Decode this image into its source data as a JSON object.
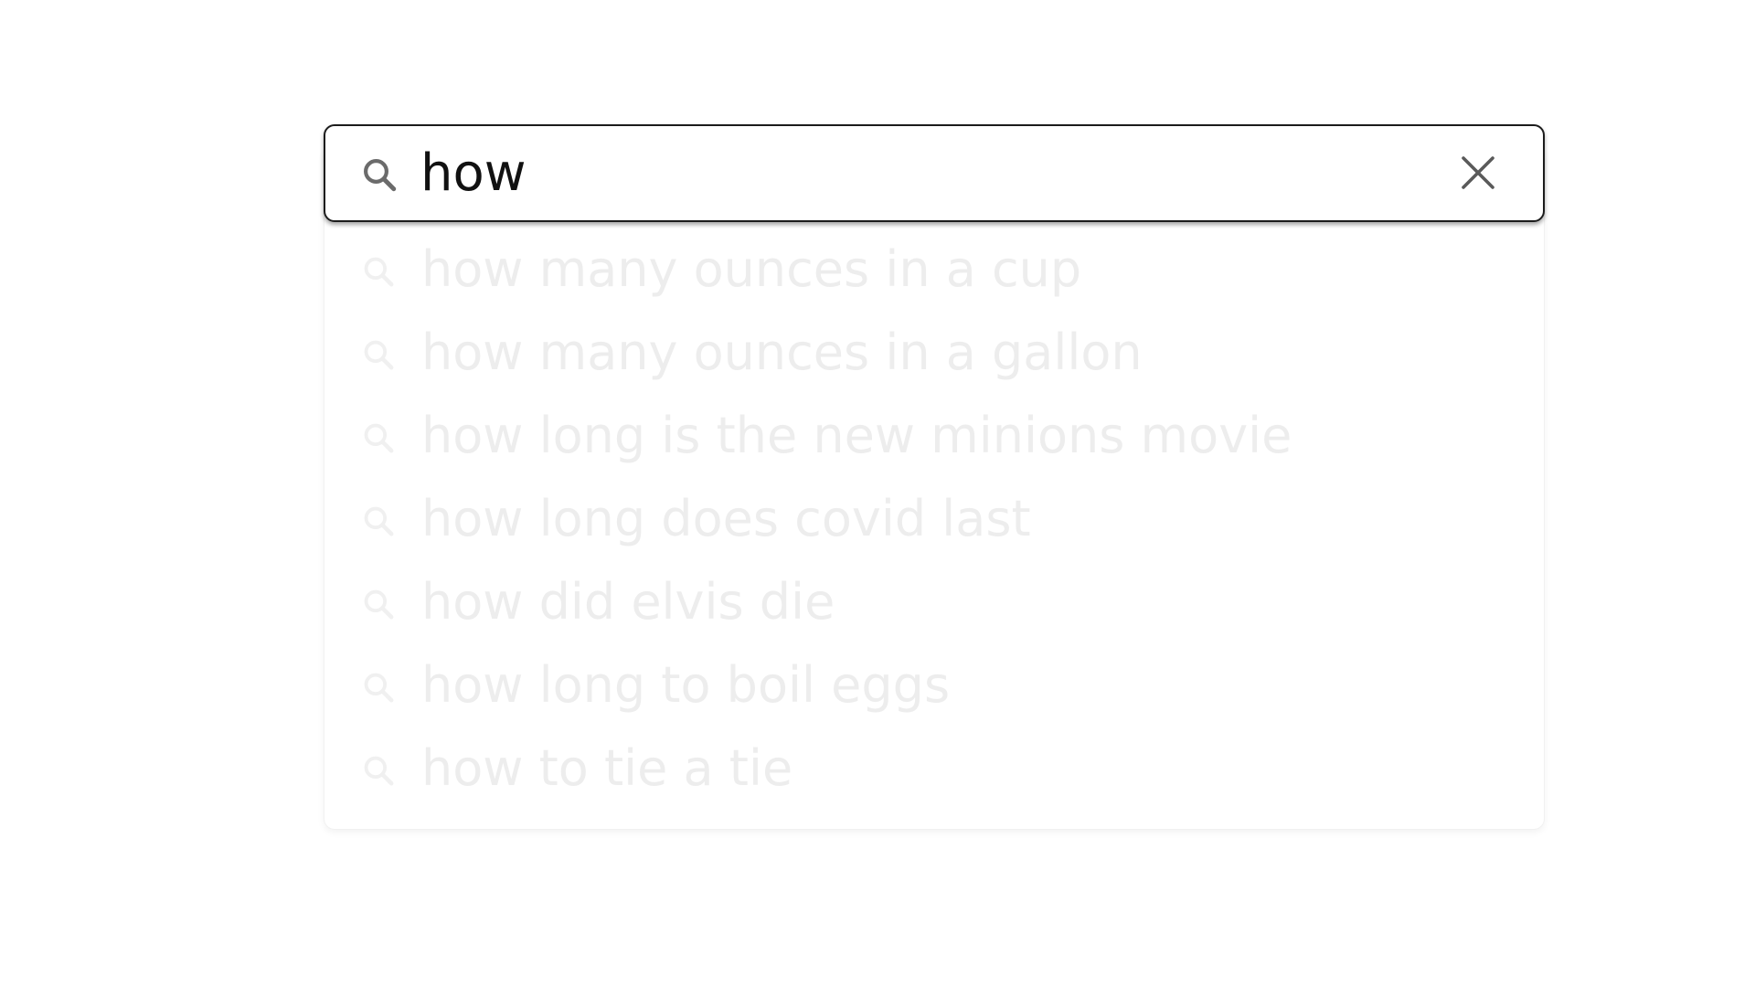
{
  "search": {
    "value": "how",
    "search_icon": "search-icon",
    "clear_icon": "close-icon"
  },
  "suggestions": {
    "icon": "search-icon",
    "items": [
      {
        "label": "how many ounces in a cup"
      },
      {
        "label": "how many ounces in a gallon"
      },
      {
        "label": "how long is the new minions movie"
      },
      {
        "label": "how long does covid last"
      },
      {
        "label": "how did elvis die"
      },
      {
        "label": "how long to boil eggs"
      },
      {
        "label": "how to tie a tie"
      }
    ]
  },
  "colors": {
    "input_border": "#1c1c1c",
    "input_text": "#111111",
    "icon": "#6b6b6b",
    "suggestion_text": "#ededed",
    "suggestion_icon": "#f0f0f0"
  }
}
